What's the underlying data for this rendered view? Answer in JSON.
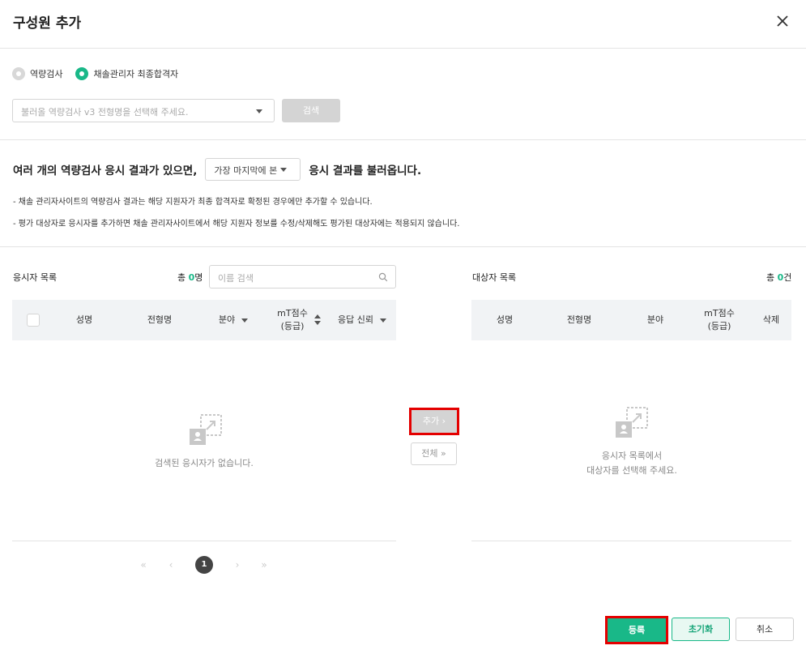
{
  "dialog": {
    "title": "구성원 추가"
  },
  "source_options": [
    {
      "label": "역량검사",
      "selected": false
    },
    {
      "label": "채솔관리자 최종합격자",
      "selected": true
    }
  ],
  "exam_select": {
    "placeholder": "불러올 역량검사 v3 전형명을 선택해 주세요.",
    "search_label": "검색"
  },
  "load_sentence": {
    "prefix": "여러 개의 역량검사 응시 결과가 있으면,",
    "select_value": "가장 마지막에 본",
    "suffix": "응시 결과를 불러옵니다."
  },
  "notes": [
    "- 채솔 관리자사이트의 역량검사 결과는 해당 지원자가 최종 합격자로 확정된 경우에만 추가할 수 있습니다.",
    "- 평가 대상자로 응시자를 추가하면 채솔 관리자사이트에서 해당 지원자 정보를 수정/삭제해도 평가된 대상자에는 적용되지 않습니다."
  ],
  "applicant_list": {
    "title": "응시자 목록",
    "count_prefix": "총",
    "count": "0",
    "count_unit": "명",
    "search_placeholder": "이름 검색",
    "columns": {
      "name": "성명",
      "stage": "전형명",
      "field": "분야",
      "score_line1": "mT점수",
      "score_line2": "(등급)",
      "trust": "응답 신뢰"
    },
    "empty_text": "검색된 응시자가 없습니다."
  },
  "transfer": {
    "add_label": "추가",
    "all_label": "전체"
  },
  "target_list": {
    "title": "대상자 목록",
    "count_prefix": "총",
    "count": "0",
    "count_unit": "건",
    "columns": {
      "name": "성명",
      "stage": "전형명",
      "field": "분야",
      "score_line1": "mT점수",
      "score_line2": "(등급)",
      "delete": "삭제"
    },
    "empty_line1": "응시자 목록에서",
    "empty_line2": "대상자를 선택해 주세요."
  },
  "pagination": {
    "current_page": "1"
  },
  "footer": {
    "register_label": "등록",
    "reset_label": "초기화",
    "cancel_label": "취소"
  },
  "colors": {
    "accent": "#19b888",
    "highlight": "#e40000"
  }
}
